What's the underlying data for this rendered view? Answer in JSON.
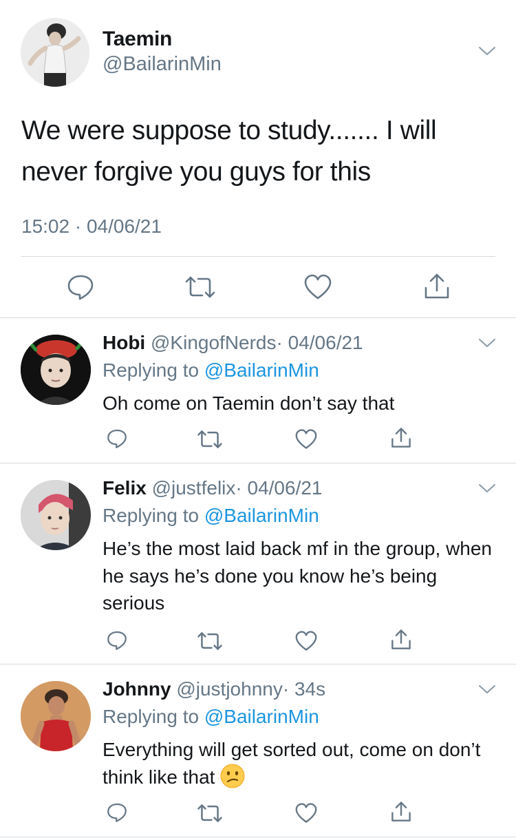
{
  "main_tweet": {
    "name": "Taemin",
    "handle": "@BailarinMin",
    "text": "We were suppose to study....... I will never forgive you guys for this",
    "timestamp": "15:02 · 04/06/21"
  },
  "replies": [
    {
      "name": "Hobi",
      "handle": "@KingofNerds",
      "time": "· 04/06/21",
      "replying_prefix": "Replying to ",
      "replying_to": "@BailarinMin",
      "text": "Oh come on Taemin don’t say that"
    },
    {
      "name": "Felix",
      "handle": "@justfelix",
      "time": "· 04/06/21",
      "replying_prefix": "Replying to ",
      "replying_to": "@BailarinMin",
      "text": "He’s the most laid back mf in the group, when he says he’s done you know he’s being serious"
    },
    {
      "name": "Johnny",
      "handle": "@justjohnny",
      "time": "· 34s",
      "replying_prefix": "Replying to ",
      "replying_to": "@BailarinMin",
      "text": "Everything will get sorted out, come on don’t think like that",
      "emoji": "confused-face-emoji"
    }
  ],
  "icons": {
    "reply": "reply-icon",
    "retweet": "retweet-icon",
    "like": "heart-icon",
    "share": "share-icon",
    "menu": "chevron-down-icon"
  },
  "colors": {
    "text_primary": "#14171a",
    "text_secondary": "#657786",
    "link": "#1b95e0",
    "divider": "#d6d9db"
  }
}
